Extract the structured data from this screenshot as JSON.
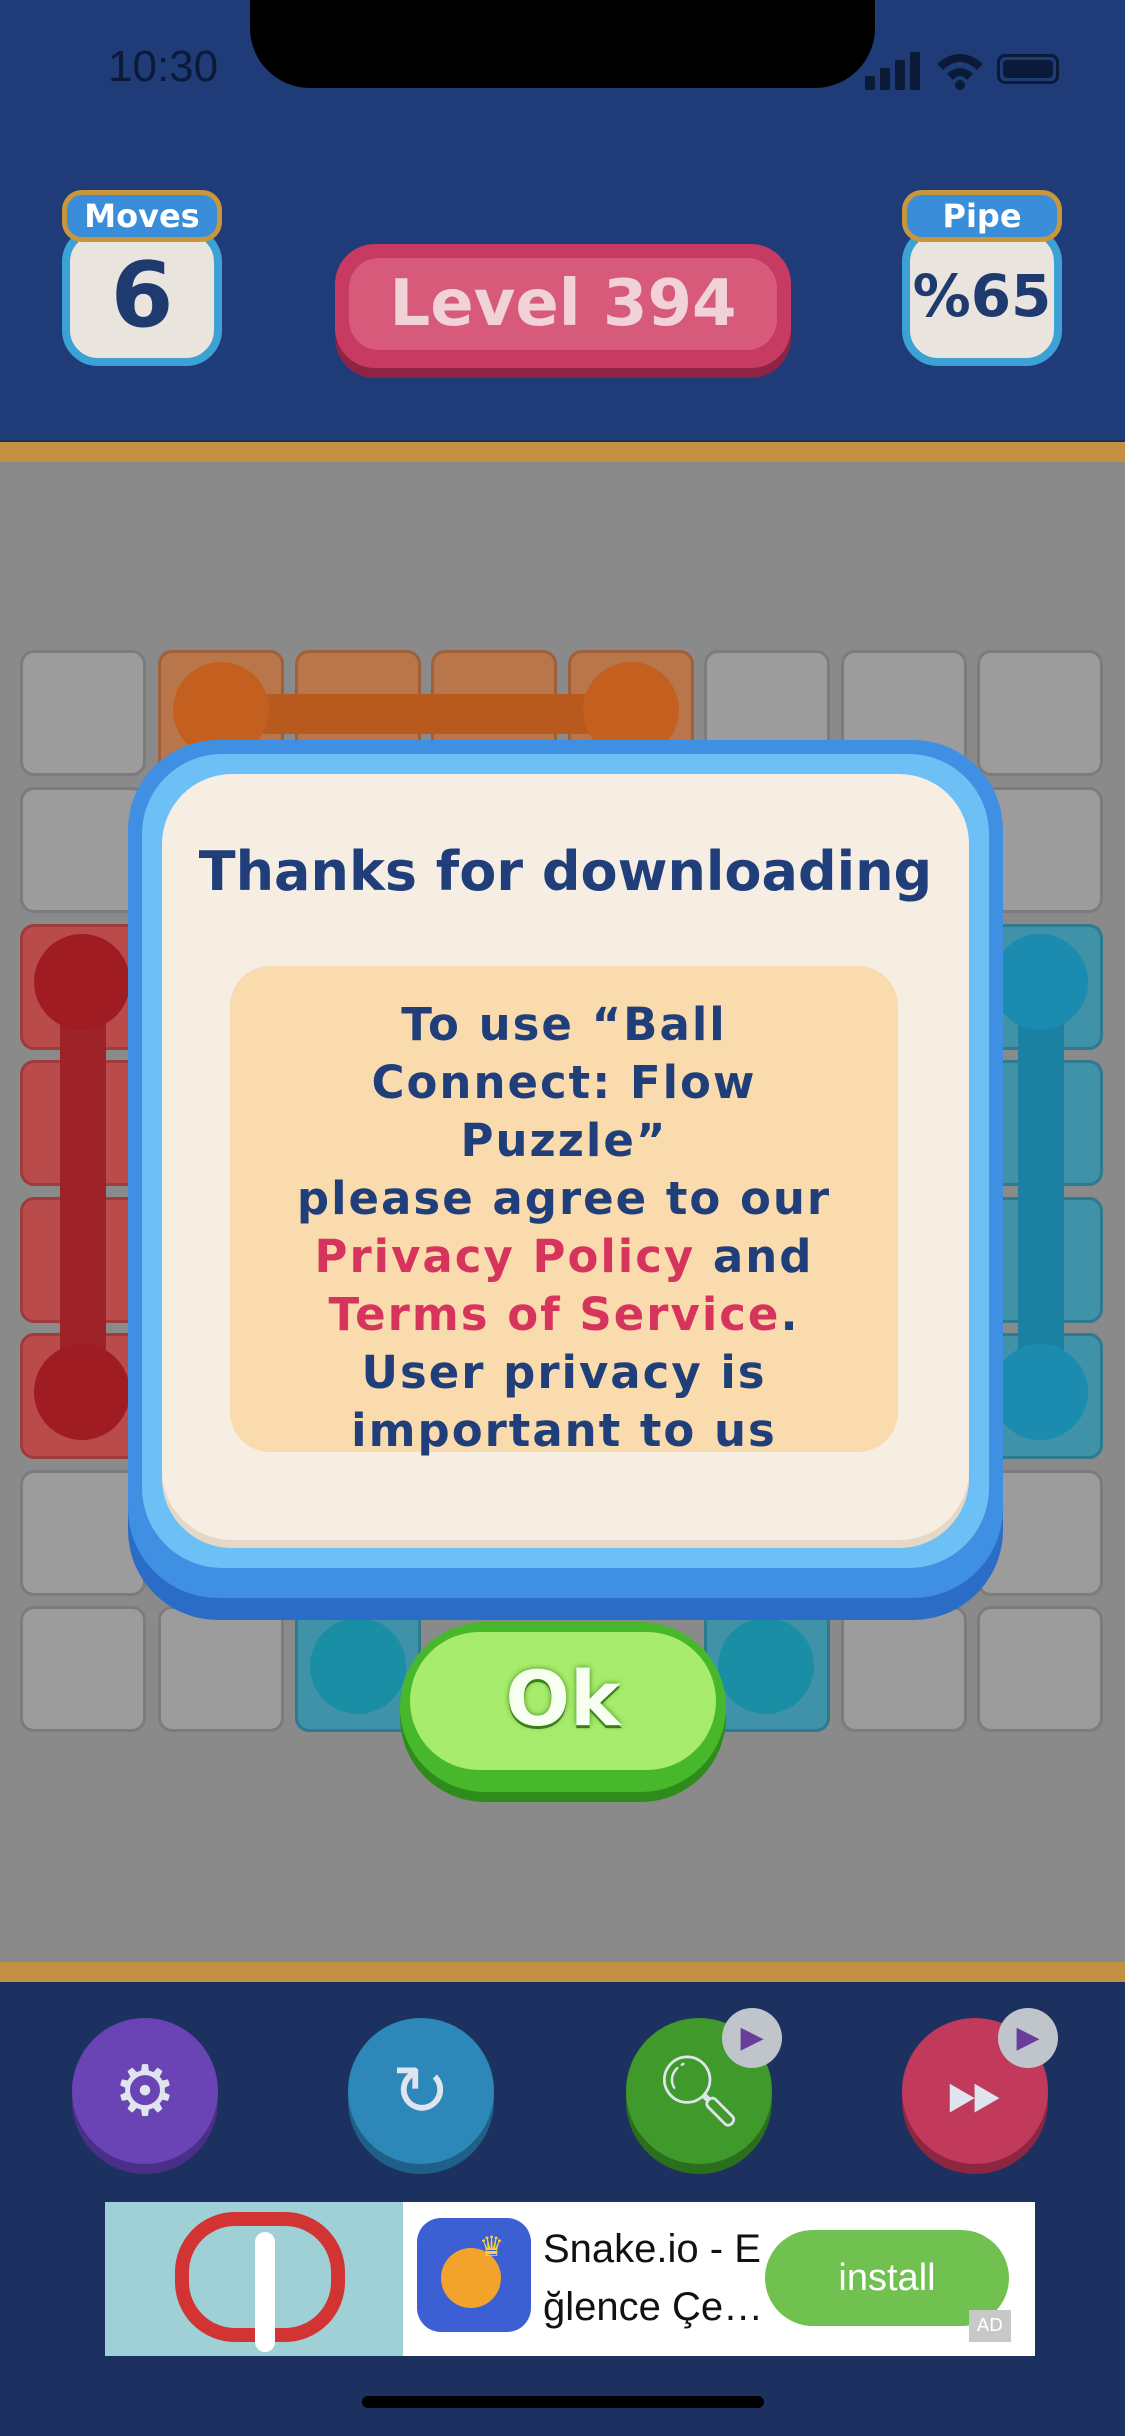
{
  "status_bar": {
    "time": "10:30"
  },
  "header": {
    "moves_label": "Moves",
    "moves_value": "6",
    "level_label": "Level 394",
    "pipe_label": "Pipe",
    "pipe_value": "%65"
  },
  "dialog": {
    "title": "Thanks for downloading",
    "message_line1": "To use “Ball",
    "message_line2": "Connect: Flow Puzzle”",
    "message_line3": "please agree to our",
    "privacy_link": "Privacy Policy",
    "and_text": "and",
    "terms_link": "Terms of Service",
    "period": ".",
    "message_line5": "User privacy is",
    "message_line6": "important to us",
    "ok_label": "Ok"
  },
  "controls": {
    "settings_icon": "gear-icon",
    "restart_icon": "restart-icon",
    "hint_icon": "magnifier-icon",
    "skip_icon": "fast-forward-icon",
    "video_badge_icon": "video-clapper-icon"
  },
  "ad": {
    "title_line1": "Snake.io - E",
    "title_line2": "ğlence Çe…",
    "install_label": "install",
    "tag": "AD"
  },
  "colors": {
    "header_bg": "#1f3c78",
    "level_pill": "#c73a62",
    "dialog_border": "#3f8fe2",
    "dialog_text": "#1f3e7a",
    "link": "#d6345d",
    "ok_button": "#a7ec6c",
    "install_button": "#70c14f"
  }
}
